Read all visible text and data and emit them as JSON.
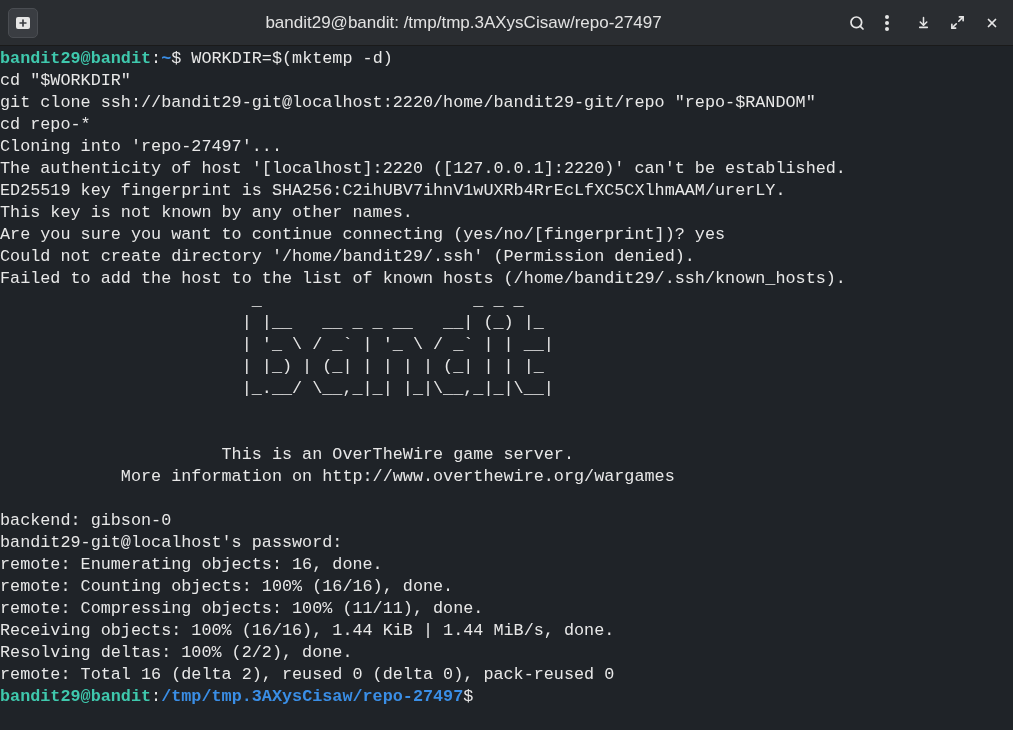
{
  "window": {
    "title": "bandit29@bandit: /tmp/tmp.3AXysCisaw/repo-27497"
  },
  "terminal": {
    "lines": [
      {
        "kind": "prompt",
        "user": "bandit29@bandit",
        "separator": ":",
        "path": "~",
        "symbol": "$",
        "command": " WORKDIR=$(mktemp -d)"
      },
      {
        "kind": "output",
        "text": "cd \"$WORKDIR\""
      },
      {
        "kind": "output",
        "text": "git clone ssh://bandit29-git@localhost:2220/home/bandit29-git/repo \"repo-$RANDOM\""
      },
      {
        "kind": "output",
        "text": "cd repo-*"
      },
      {
        "kind": "output",
        "text": "Cloning into 'repo-27497'..."
      },
      {
        "kind": "output",
        "text": "The authenticity of host '[localhost]:2220 ([127.0.0.1]:2220)' can't be established."
      },
      {
        "kind": "output",
        "text": "ED25519 key fingerprint is SHA256:C2ihUBV7ihnV1wUXRb4RrEcLfXC5CXlhmAAM/urerLY."
      },
      {
        "kind": "output",
        "text": "This key is not known by any other names."
      },
      {
        "kind": "output",
        "text": "Are you sure you want to continue connecting (yes/no/[fingerprint])? yes"
      },
      {
        "kind": "output",
        "text": "Could not create directory '/home/bandit29/.ssh' (Permission denied)."
      },
      {
        "kind": "output",
        "text": "Failed to add the host to the list of known hosts (/home/bandit29/.ssh/known_hosts)."
      },
      {
        "kind": "art",
        "text": "                         _                     _ _ _"
      },
      {
        "kind": "art",
        "text": "                        | |__   __ _ _ __   __| (_) |_"
      },
      {
        "kind": "art",
        "text": "                        | '_ \\ / _` | '_ \\ / _` | | __|"
      },
      {
        "kind": "art",
        "text": "                        | |_) | (_| | | | | (_| | | |_"
      },
      {
        "kind": "art",
        "text": "                        |_.__/ \\__,_|_| |_|\\__,_|_|\\__|"
      },
      {
        "kind": "blank"
      },
      {
        "kind": "blank"
      },
      {
        "kind": "output",
        "text": "                      This is an OverTheWire game server."
      },
      {
        "kind": "output",
        "text": "            More information on http://www.overthewire.org/wargames"
      },
      {
        "kind": "blank"
      },
      {
        "kind": "output",
        "text": "backend: gibson-0"
      },
      {
        "kind": "output",
        "text": "bandit29-git@localhost's password:"
      },
      {
        "kind": "output",
        "text": "remote: Enumerating objects: 16, done."
      },
      {
        "kind": "output",
        "text": "remote: Counting objects: 100% (16/16), done."
      },
      {
        "kind": "output",
        "text": "remote: Compressing objects: 100% (11/11), done."
      },
      {
        "kind": "output",
        "text": "Receiving objects: 100% (16/16), 1.44 KiB | 1.44 MiB/s, done."
      },
      {
        "kind": "output",
        "text": "Resolving deltas: 100% (2/2), done."
      },
      {
        "kind": "output",
        "text": "remote: Total 16 (delta 2), reused 0 (delta 0), pack-reused 0"
      },
      {
        "kind": "prompt",
        "user": "bandit29@bandit",
        "separator": ":",
        "path": "/tmp/tmp.3AXysCisaw/repo-27497",
        "symbol": "$"
      }
    ]
  }
}
